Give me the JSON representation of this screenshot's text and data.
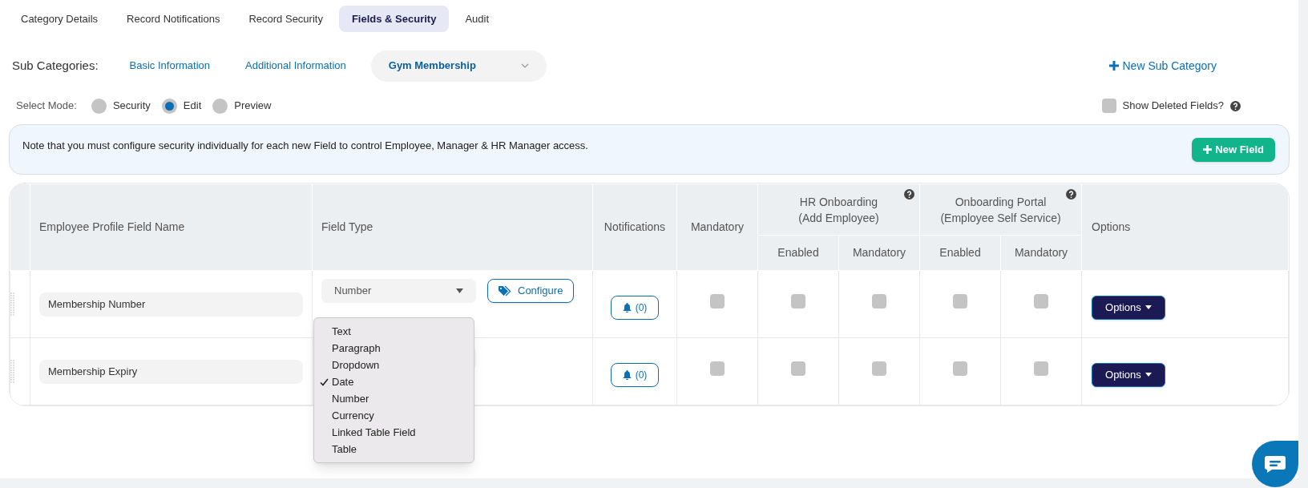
{
  "tabs": [
    {
      "label": "Category Details",
      "selected": false
    },
    {
      "label": "Record Notifications",
      "selected": false
    },
    {
      "label": "Record Security",
      "selected": false
    },
    {
      "label": "Fields & Security",
      "selected": true
    },
    {
      "label": "Audit",
      "selected": false
    }
  ],
  "sub_categories": {
    "label": "Sub Categories:",
    "items": [
      {
        "label": "Basic Information",
        "selected": false
      },
      {
        "label": "Additional Information",
        "selected": false
      },
      {
        "label": "Gym Membership",
        "selected": true
      }
    ],
    "new_button": "New Sub Category"
  },
  "mode": {
    "label": "Select Mode:",
    "options": [
      {
        "label": "Security",
        "selected": false
      },
      {
        "label": "Edit",
        "selected": true
      },
      {
        "label": "Preview",
        "selected": false
      }
    ]
  },
  "show_deleted": {
    "label": "Show Deleted Fields?",
    "checked": false
  },
  "note": {
    "text": "Note that you must configure security individually for each new Field to control Employee, Manager & HR Manager access.",
    "button": "New Field"
  },
  "table": {
    "columns": {
      "name": "Employee Profile Field Name",
      "field_type": "Field Type",
      "notifications": "Notifications",
      "mandatory": "Mandatory",
      "hr_onboarding": {
        "title": "HR Onboarding\n(Add Employee)",
        "enabled": "Enabled",
        "mandatory": "Mandatory"
      },
      "onboarding_portal": {
        "title": "Onboarding Portal\n(Employee Self Service)",
        "enabled": "Enabled",
        "mandatory": "Mandatory"
      },
      "options": "Options"
    },
    "rows": [
      {
        "field_name": "Membership Number",
        "field_type": "Number",
        "configure": "Configure",
        "notifications": "(0)",
        "mandatory": false,
        "hr_enabled": false,
        "hr_mandatory": false,
        "portal_enabled": false,
        "portal_mandatory": false,
        "options": "Options"
      },
      {
        "field_name": "Membership Expiry",
        "notifications": "(0)",
        "mandatory": false,
        "hr_enabled": false,
        "hr_mandatory": false,
        "portal_enabled": false,
        "portal_mandatory": false,
        "options": "Options"
      }
    ]
  },
  "field_type_menu": {
    "items": [
      {
        "label": "Text",
        "checked": false
      },
      {
        "label": "Paragraph",
        "checked": false
      },
      {
        "label": "Dropdown",
        "checked": false
      },
      {
        "label": "Date",
        "checked": true
      },
      {
        "label": "Number",
        "checked": false
      },
      {
        "label": "Currency",
        "checked": false
      },
      {
        "label": "Linked Table Field",
        "checked": false
      },
      {
        "label": "Table",
        "checked": false
      }
    ]
  }
}
